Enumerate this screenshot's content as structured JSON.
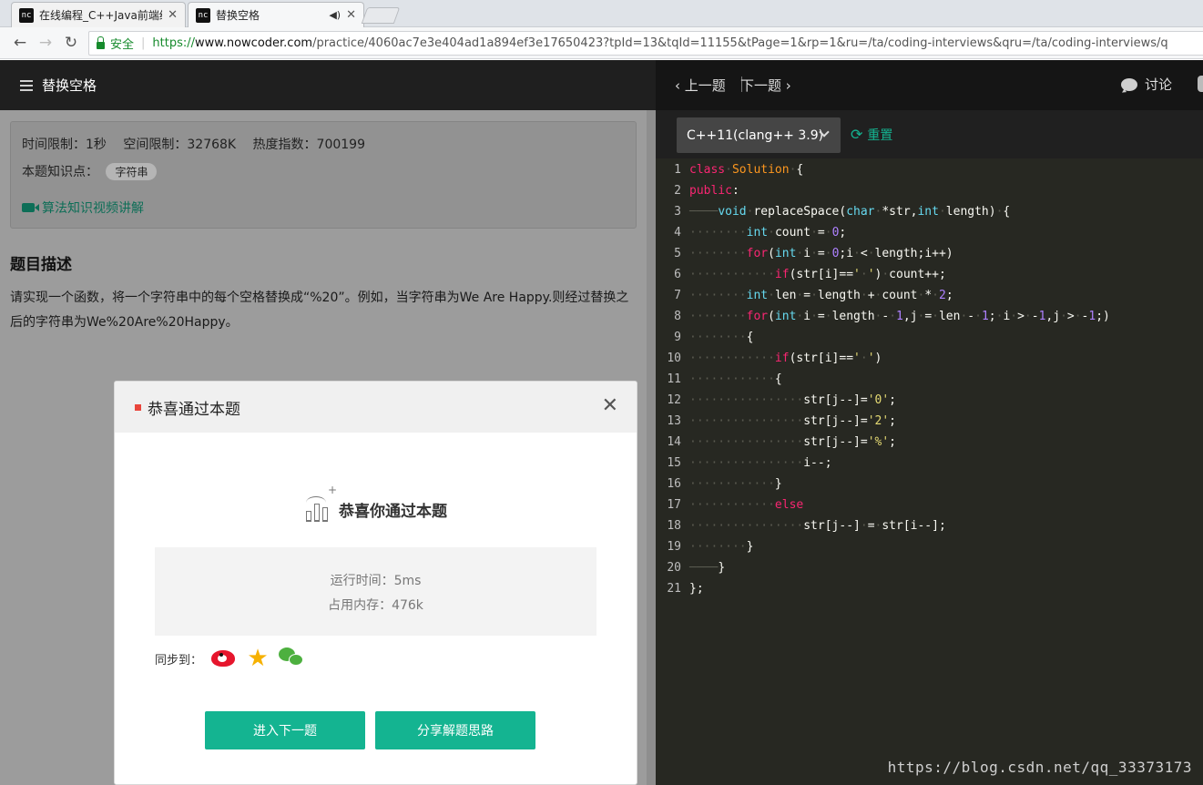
{
  "browser": {
    "tabs": [
      {
        "title": "在线编程_C++Java前端经",
        "favicon": "logo-icon"
      },
      {
        "title": "替换空格",
        "favicon": "logo-icon"
      }
    ],
    "favicon_text": "nc",
    "secure_label": "安全",
    "url": {
      "scheme": "https://",
      "host": "www.nowcoder.com",
      "rest": "/practice/4060ac7e3e404ad1a894ef3e17650423?tpId=13&tqId=11155&tPage=1&rp=1&ru=/ta/coding-interviews&qru=/ta/coding-interviews/q"
    }
  },
  "left": {
    "title": "替换空格",
    "info": {
      "time_limit": "时间限制：1秒",
      "space_limit": "空间限制：32768K",
      "heat": "热度指数：700199",
      "knowledge_label": "本题知识点：",
      "tag": "字符串",
      "video_link": "算法知识视频讲解"
    },
    "desc_title": "题目描述",
    "desc_body": "请实现一个函数，将一个字符串中的每个空格替换成“%20”。例如，当字符串为We Are Happy.则经过替换之后的字符串为We%20Are%20Happy。"
  },
  "modal": {
    "title": "恭喜通过本题",
    "success_text": "恭喜你通过本题",
    "run_time": "运行时间：5ms",
    "memory": "占用内存：476k",
    "sync_label": "同步到：",
    "share_targets": [
      "weibo-icon",
      "qzone-icon",
      "wechat-icon"
    ],
    "next_button": "进入下一题",
    "share_button": "分享解题思路"
  },
  "right": {
    "prev": "上一题",
    "next": "下一题",
    "discuss": "讨论",
    "language": "C++11(clang++ 3.9)",
    "reset": "重置"
  },
  "code": [
    {
      "n": "1",
      "html": "<span class='kw'>class</span><span class='ws'>·</span><span class='cls'>Solution</span><span class='ws'>·</span>{"
    },
    {
      "n": "2",
      "html": "<span class='kw'>public</span>:"
    },
    {
      "n": "3",
      "html": "<span class='ws'>────</span><span class='ty'>void</span><span class='ws'>·</span>replaceSpace(<span class='ty'>char</span><span class='ws'>·</span>*str,<span class='ty'>int</span><span class='ws'>·</span>length)<span class='ws'>·</span>{"
    },
    {
      "n": "4",
      "html": "<span class='ws'>········</span><span class='ty'>int</span><span class='ws'>·</span>count<span class='ws'>·</span>=<span class='ws'>·</span><span class='num'>0</span>;"
    },
    {
      "n": "5",
      "html": "<span class='ws'>········</span><span class='kw'>for</span>(<span class='ty'>int</span><span class='ws'>·</span>i<span class='ws'>·</span>=<span class='ws'>·</span><span class='num'>0</span>;i<span class='ws'>·</span>&lt;<span class='ws'>·</span>length;i++)"
    },
    {
      "n": "6",
      "html": "<span class='ws'>············</span><span class='kw'>if</span>(str[i]==<span class='str'>'<span class=\"ws\">·</span>'</span>)<span class='ws'>·</span>count++;"
    },
    {
      "n": "7",
      "html": "<span class='ws'>········</span><span class='ty'>int</span><span class='ws'>·</span>len<span class='ws'>·</span>=<span class='ws'>·</span>length<span class='ws'>·</span>+<span class='ws'>·</span>count<span class='ws'>·</span>*<span class='ws'>·</span><span class='num'>2</span>;"
    },
    {
      "n": "8",
      "html": "<span class='ws'>········</span><span class='kw'>for</span>(<span class='ty'>int</span><span class='ws'>·</span>i<span class='ws'>·</span>=<span class='ws'>·</span>length<span class='ws'>·</span>-<span class='ws'>·</span><span class='num'>1</span>,j<span class='ws'>·</span>=<span class='ws'>·</span>len<span class='ws'>·</span>-<span class='ws'>·</span><span class='num'>1</span>;<span class='ws'>·</span>i<span class='ws'>·</span>&gt;<span class='ws'>·</span>-<span class='num'>1</span>,j<span class='ws'>·</span>&gt;<span class='ws'>·</span>-<span class='num'>1</span>;)"
    },
    {
      "n": "9",
      "html": "<span class='ws'>········</span>{"
    },
    {
      "n": "10",
      "html": "<span class='ws'>············</span><span class='kw'>if</span>(str[i]==<span class='str'>'<span class=\"ws\">·</span>'</span>)"
    },
    {
      "n": "11",
      "html": "<span class='ws'>············</span>{"
    },
    {
      "n": "12",
      "html": "<span class='ws'>················</span>str[j--]=<span class='str'>'0'</span>;"
    },
    {
      "n": "13",
      "html": "<span class='ws'>················</span>str[j--]=<span class='str'>'2'</span>;"
    },
    {
      "n": "14",
      "html": "<span class='ws'>················</span>str[j--]=<span class='str'>'%'</span>;"
    },
    {
      "n": "15",
      "html": "<span class='ws'>················</span>i--;"
    },
    {
      "n": "16",
      "html": "<span class='ws'>············</span>}"
    },
    {
      "n": "17",
      "html": "<span class='ws'>············</span><span class='kw'>else</span>"
    },
    {
      "n": "18",
      "html": "<span class='ws'>················</span>str[j--]<span class='ws'>·</span>=<span class='ws'>·</span>str[i--];"
    },
    {
      "n": "19",
      "html": "<span class='ws'>········</span>}"
    },
    {
      "n": "20",
      "html": "<span class='ws'>────</span>}"
    },
    {
      "n": "21",
      "html": "};"
    }
  ],
  "watermark": "https://blog.csdn.net/qq_33373173"
}
